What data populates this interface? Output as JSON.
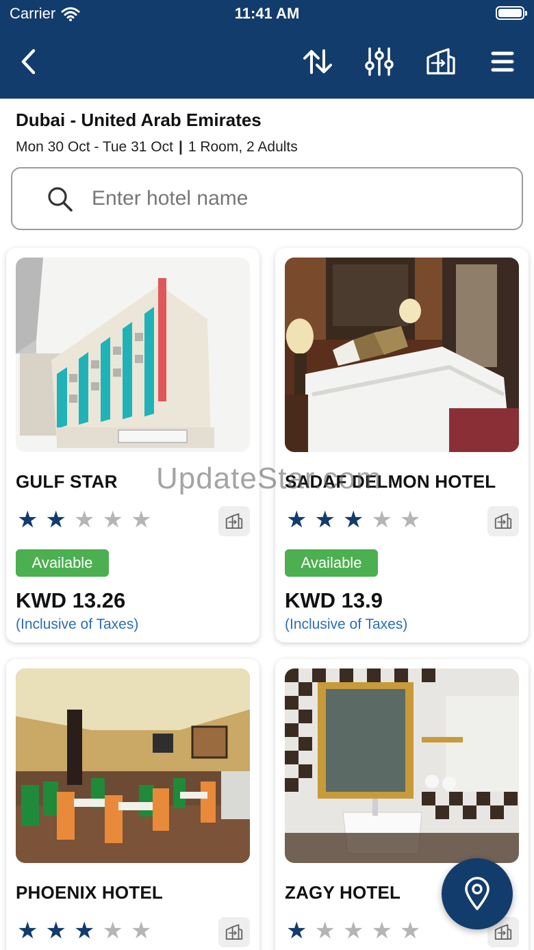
{
  "status": {
    "carrier": "Carrier",
    "time": "11:41 AM"
  },
  "nav": {
    "back_icon": "chevron-left-icon",
    "sort_icon": "sort-icon",
    "filter_icon": "sliders-icon",
    "compare_icon": "compare-hotels-icon",
    "menu_icon": "hamburger-menu-icon"
  },
  "search_header": {
    "destination": "Dubai - United Arab Emirates",
    "dates": "Mon 30 Oct - Tue 31 Oct",
    "separator": "|",
    "occupancy": "1 Room, 2 Adults"
  },
  "search": {
    "placeholder": "Enter hotel name",
    "value": ""
  },
  "hotels": [
    {
      "name": "GULF STAR",
      "rating": 2,
      "availability": "Available",
      "price": "KWD 13.26",
      "tax_note": "(Inclusive of Taxes)"
    },
    {
      "name": "SADAF DELMON HOTEL",
      "rating": 3,
      "availability": "Available",
      "price": "KWD 13.9",
      "tax_note": "(Inclusive of Taxes)"
    },
    {
      "name": "PHOENIX HOTEL",
      "rating": 3
    },
    {
      "name": "ZAGY HOTEL",
      "rating": 1
    }
  ],
  "watermark": "UpdateStar.com",
  "colors": {
    "primary": "#123c6b",
    "available": "#4caf50",
    "tax_link": "#2a6eb6",
    "star_off": "#b5b5b5"
  },
  "fab": {
    "icon": "map-pin-icon"
  }
}
